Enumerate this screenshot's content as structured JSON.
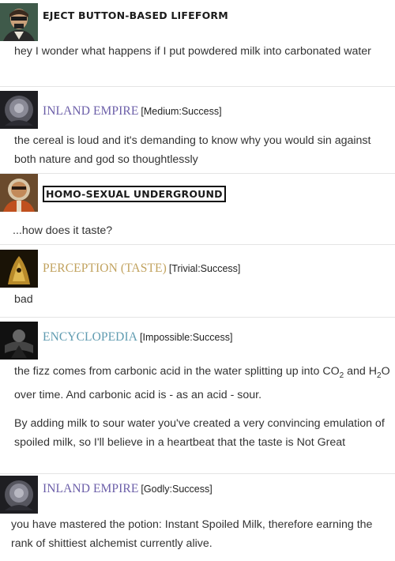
{
  "posts": [
    {
      "speaker": "EJECT BUTTON-BASED LIFEFORM",
      "lines": [
        "hey I wonder what happens if I put powdered milk into carbonated water"
      ]
    },
    {
      "speaker": "INLAND EMPIRE",
      "check": "[Medium:Success]",
      "color": "#6b5ea8",
      "lines": [
        "the cereal is loud and it's demanding to know why you would sin against both nature and god so thoughtlessly"
      ]
    },
    {
      "speaker": "HOMO-SEXUAL UNDERGROUND",
      "lines": [
        "...how does it taste?"
      ]
    },
    {
      "speaker": "PERCEPTION (TASTE)",
      "check": "[Trivial:Success]",
      "color": "#c1a25e",
      "lines": [
        "bad"
      ]
    },
    {
      "speaker": "ENCYCLOPEDIA",
      "check": "[Impossible:Success]",
      "color": "#5f9bb0",
      "para1_a": "the fizz comes from carbonic acid in the water splitting up into CO",
      "para1_b": "and H",
      "para1_c": "O over time. And carbonic acid is - as an acid - sour.",
      "para2": "By adding milk to sour water you've created a very convincing emulation of spoiled milk, so I'll believe in a heartbeat that the taste is Not Great",
      "sub2": "2"
    },
    {
      "speaker": "INLAND EMPIRE",
      "check": "[Godly:Success]",
      "color": "#6b5ea8",
      "lines": [
        "you have mastered the potion: Instant Spoiled Milk, therefore earning the rank of shittiest alchemist currently alive."
      ]
    }
  ]
}
